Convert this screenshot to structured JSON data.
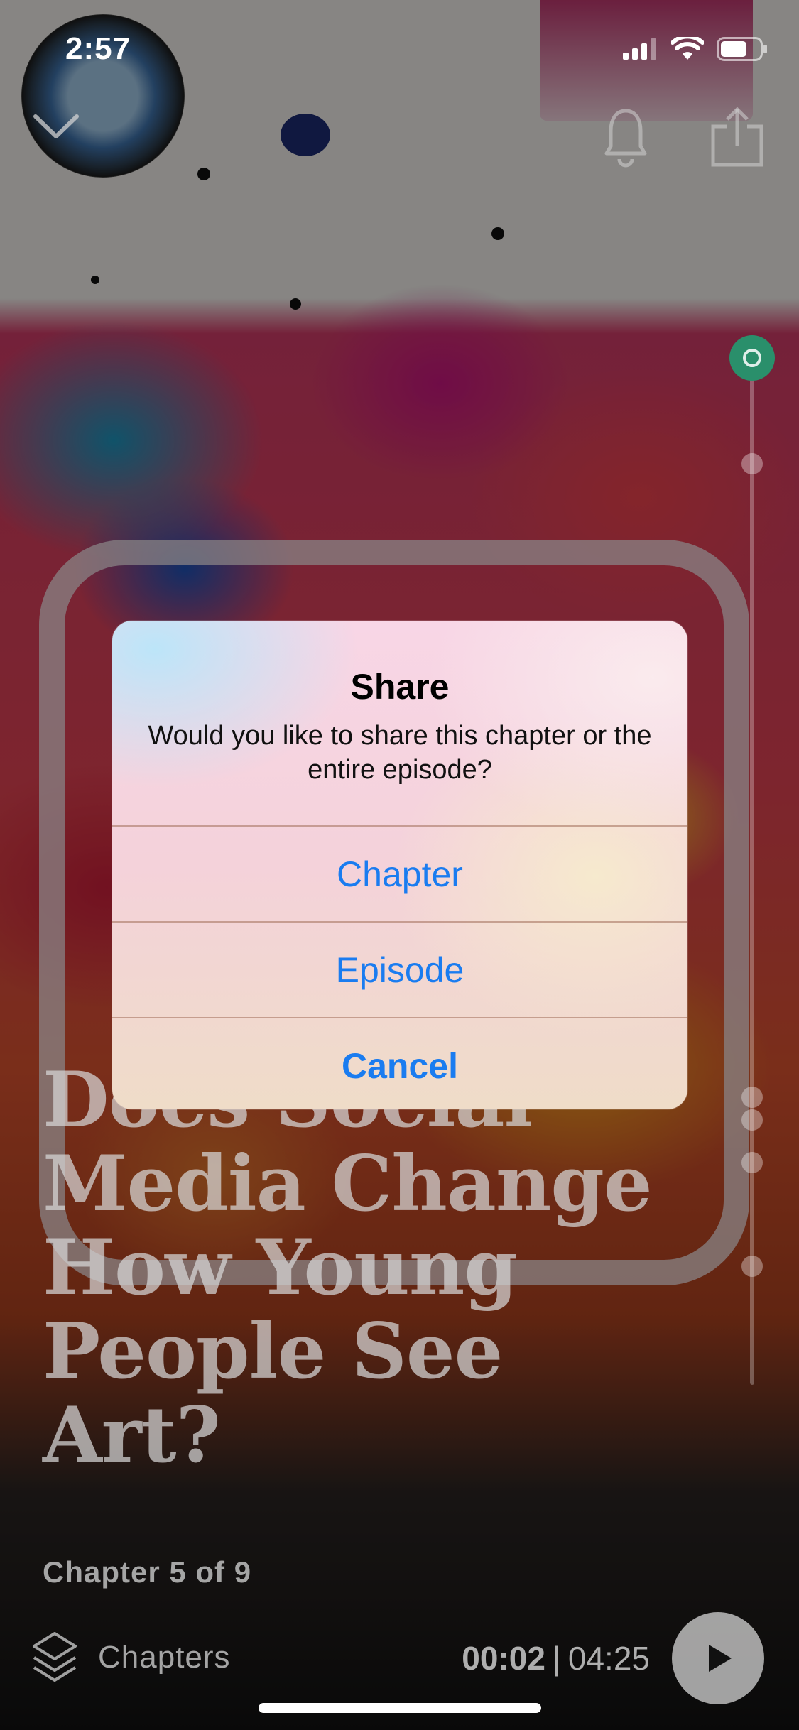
{
  "status_bar": {
    "time": "2:57"
  },
  "top_controls": {
    "collapse_icon": "chevron-down-icon",
    "alert_icon": "bell-icon",
    "share_icon": "share-icon"
  },
  "episode": {
    "title": "Does Social Media Change How Young People See Art?",
    "chapter_count": "Chapter 5 of 9"
  },
  "player": {
    "chapters_label": "Chapters",
    "current_time": "00:02",
    "separator": "|",
    "duration": "04:25"
  },
  "alert": {
    "title": "Share",
    "message": "Would you like to share this chapter or the entire episode?",
    "buttons": [
      {
        "label": "Chapter"
      },
      {
        "label": "Episode"
      },
      {
        "label": "Cancel"
      }
    ]
  },
  "colors": {
    "accent": "#1a7cf0",
    "timeline_current": "#2a8f6b"
  }
}
